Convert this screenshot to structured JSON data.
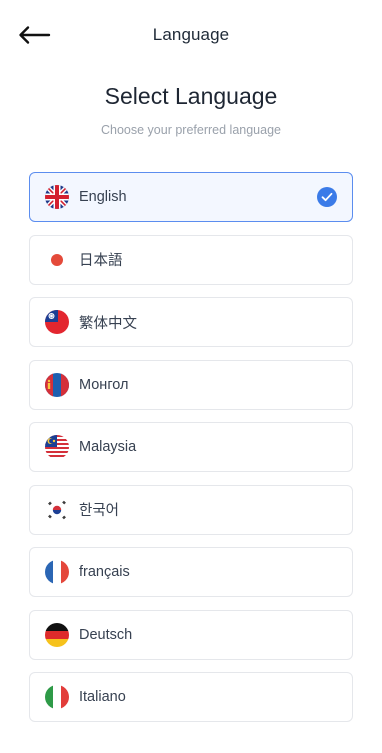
{
  "header": {
    "title": "Language",
    "back_icon": "arrow-left-icon"
  },
  "page": {
    "heading": "Select Language",
    "subheading": "Choose your preferred language"
  },
  "languages": [
    {
      "label": "English",
      "flag": "uk-flag-icon",
      "selected": true
    },
    {
      "label": "日本語",
      "flag": "japan-flag-icon",
      "selected": false
    },
    {
      "label": "繁体中文",
      "flag": "taiwan-flag-icon",
      "selected": false
    },
    {
      "label": "Монгол",
      "flag": "mongolia-flag-icon",
      "selected": false
    },
    {
      "label": "Malaysia",
      "flag": "malaysia-flag-icon",
      "selected": false
    },
    {
      "label": "한국어",
      "flag": "korea-flag-icon",
      "selected": false
    },
    {
      "label": "français",
      "flag": "france-flag-icon",
      "selected": false
    },
    {
      "label": "Deutsch",
      "flag": "germany-flag-icon",
      "selected": false
    },
    {
      "label": "Italiano",
      "flag": "italy-flag-icon",
      "selected": false
    }
  ],
  "colors": {
    "accent": "#3b7be8",
    "selected_border": "#5b8def",
    "selected_bg": "#f3f7ff"
  }
}
